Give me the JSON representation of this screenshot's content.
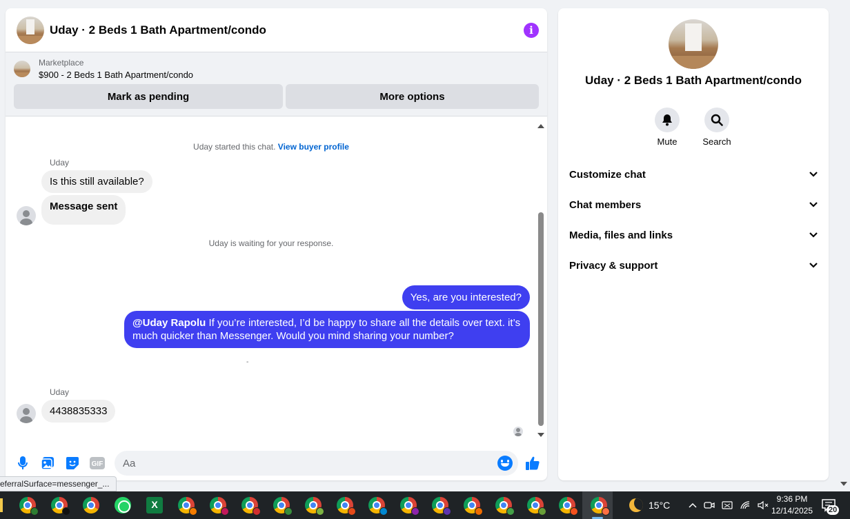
{
  "chat": {
    "title": "Uday · 2 Beds 1 Bath Apartment/condo",
    "listing": {
      "label": "Marketplace",
      "price_title": "$900 - 2 Beds 1 Bath Apartment/condo",
      "mark_pending": "Mark as pending",
      "more_options": "More options"
    },
    "started_prefix": "Uday started this chat.",
    "view_profile": "View buyer profile",
    "sender_name_1": "Uday",
    "msg_1": "Is this still available?",
    "msg_2": "Message sent",
    "waiting": "Uday is waiting for your response.",
    "out_1": "Yes, are you interested?",
    "out_2_mention": "@Uday Rapolu",
    "out_2_text": " If you’re interested, I’d be happy to share all the details over text. it’s much quicker than Messenger. Would you mind sharing your number?",
    "dot": "-",
    "sender_name_2": "Uday",
    "msg_3": "4438835333",
    "composer_placeholder": "Aa"
  },
  "status_url": "eferralSurface=messenger_...",
  "info": {
    "title": "Uday · 2 Beds 1 Bath Apartment/condo",
    "mute_label": "Mute",
    "search_label": "Search",
    "sections": [
      "Customize chat",
      "Chat members",
      "Media, files and links",
      "Privacy & support"
    ]
  },
  "taskbar": {
    "temperature": "15°C",
    "time": "9:36 PM",
    "date": "12/14/2025",
    "notification_count": "20"
  },
  "colors": {
    "accent_blue": "#0a7cff",
    "outgoing_bubble": "#3f3ff0",
    "info_purple": "#a033ff",
    "link": "#0064d1"
  }
}
